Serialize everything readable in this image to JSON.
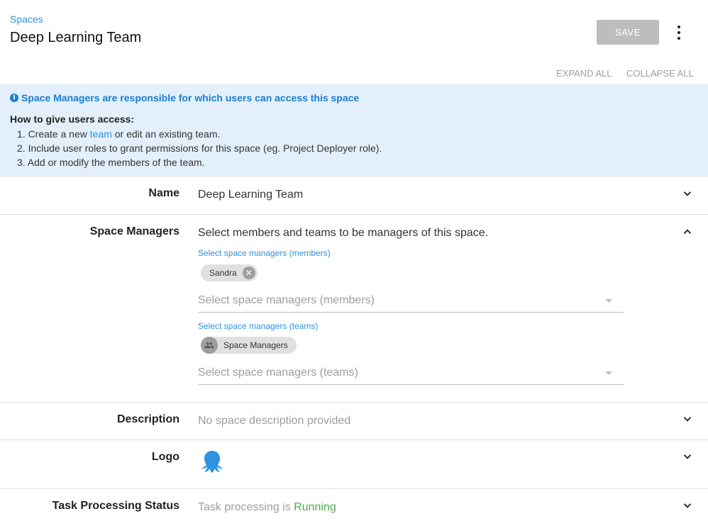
{
  "header": {
    "breadcrumb": "Spaces",
    "title": "Deep Learning Team",
    "save_label": "SAVE",
    "menu_icon": "more-vert-icon",
    "expand_all": "EXPAND ALL",
    "collapse_all": "COLLAPSE ALL"
  },
  "callout": {
    "icon": "info-icon",
    "title": "Space Managers are responsible for which users can access this space",
    "how_title": "How to give users access:",
    "step1_prefix": "1. Create a new ",
    "step1_link": "team",
    "step1_suffix": " or edit an existing team.",
    "step2": "2. Include user roles to grant permissions for this space (eg. Project Deployer role).",
    "step3": "3. Add or modify the members of the team."
  },
  "name": {
    "label": "Name",
    "value": "Deep Learning Team"
  },
  "space_managers": {
    "label": "Space Managers",
    "summary": "Select members and teams to be managers of this space.",
    "members_label": "Select space managers (members)",
    "members_chips": [
      "Sandra"
    ],
    "members_placeholder": "Select space managers (members)",
    "teams_label": "Select space managers (teams)",
    "teams_chips": [
      "Space Managers"
    ],
    "teams_placeholder": "Select space managers (teams)"
  },
  "description": {
    "label": "Description",
    "value": "No space description provided"
  },
  "logo": {
    "label": "Logo",
    "icon": "octopus-logo-icon"
  },
  "task_processing": {
    "label": "Task Processing Status",
    "value_prefix": "Task processing is ",
    "status": "Running"
  },
  "colors": {
    "accent": "#2f93e0",
    "callout_bg": "#e3f0fb",
    "running": "#4caf50",
    "save_disabled": "#bdbdbd"
  }
}
